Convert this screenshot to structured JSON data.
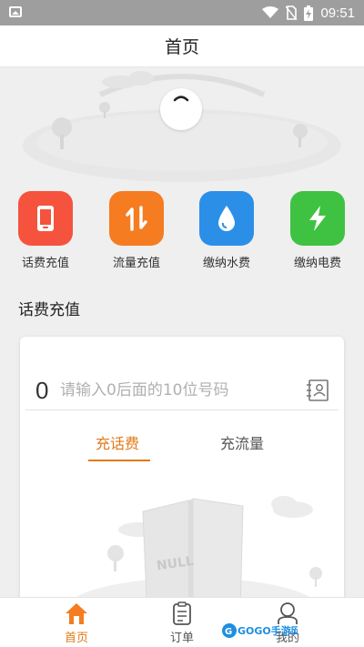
{
  "status_bar": {
    "time": "09:51",
    "icons": [
      "gallery-icon",
      "wifi-icon",
      "no-sim-icon",
      "battery-charging-icon"
    ]
  },
  "header": {
    "title": "首页"
  },
  "services": [
    {
      "label": "话费充值",
      "icon": "phone-icon",
      "color": "#f5533d"
    },
    {
      "label": "流量充值",
      "icon": "transfer-arrows-icon",
      "color": "#f57c20"
    },
    {
      "label": "缴纳水费",
      "icon": "water-drop-icon",
      "color": "#2b8fe8"
    },
    {
      "label": "缴纳电费",
      "icon": "lightning-icon",
      "color": "#3fc242"
    }
  ],
  "recharge": {
    "section_title": "话费充值",
    "prefix": "0",
    "input_placeholder": "请输入0后面的10位号码",
    "input_value": "",
    "tabs": [
      {
        "label": "充话费",
        "active": true
      },
      {
        "label": "充流量",
        "active": false
      }
    ],
    "empty_image_text": "NULL"
  },
  "tabbar": {
    "items": [
      {
        "label": "首页",
        "icon": "home-icon",
        "active": true
      },
      {
        "label": "订单",
        "icon": "order-icon",
        "active": false
      },
      {
        "label": "我的",
        "icon": "user-icon",
        "active": false
      }
    ]
  },
  "watermark": {
    "text": "GOGO手游网"
  },
  "colors": {
    "accent": "#e07a17",
    "statusbar": "#9e9e9e",
    "background": "#efefef"
  }
}
